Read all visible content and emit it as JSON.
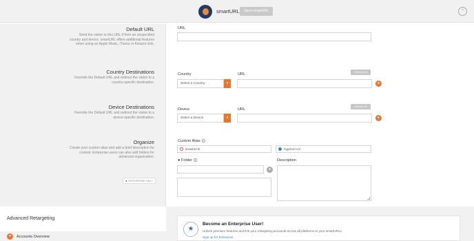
{
  "topbar": {
    "title": "smartURL",
    "save_label": "Save smartURL",
    "collapse_glyph": "⌃"
  },
  "sections": {
    "default_url": {
      "heading": "Default URL",
      "description": "Send the visitor to this URL if from an unspecified country and device. smartURL offers additional features when using an Apple Music, iTunes or Amazon link.",
      "url_label": "URL",
      "url_value": ""
    },
    "country": {
      "heading": "Country Destinations",
      "description": "Override the Default URL and redirect the visitor to a country-specific destination.",
      "country_label": "Country",
      "url_label": "URL",
      "select_value": "Select a Country",
      "remove_label": "Remove All"
    },
    "device": {
      "heading": "Device Destinations",
      "description": "Override the Default URL and redirect the visitor to a device-specific destination.",
      "device_label": "Device",
      "url_label": "URL",
      "select_value": "Select a Device",
      "remove_label": "Remove All"
    },
    "organize": {
      "heading": "Organize",
      "description": "Create your custom alias and add a brief description for context. Enterprise users can also add folders for advanced organization.",
      "badge": "ENTERPRISE ONLY",
      "alias_label": "Custom Alias",
      "alias_domain_1": "smarturl.it/",
      "alias_domain_2": "hyperurl.co/",
      "folder_label": "Folder",
      "description_label": "Description"
    }
  },
  "bottom": {
    "advanced_retargeting": "Advanced Retargeting",
    "accounts_overview": "Accounts Overview",
    "enterprise": {
      "title": "Become an Enterprise User!",
      "desc": "Unlock premium features and link your retargeting accounts across all platforms to your smartURLs.",
      "link": "Sign up for Enterprise"
    }
  },
  "colors": {
    "accent": "#e8762b",
    "link": "#3b82c6",
    "panel": "#f1f1f1"
  },
  "icons": [
    "avatar",
    "chevron-up-icon",
    "dropdown-arrow-icon",
    "plus-circle-icon",
    "info-icon",
    "radio-icon",
    "star-icon",
    "person-icon"
  ]
}
